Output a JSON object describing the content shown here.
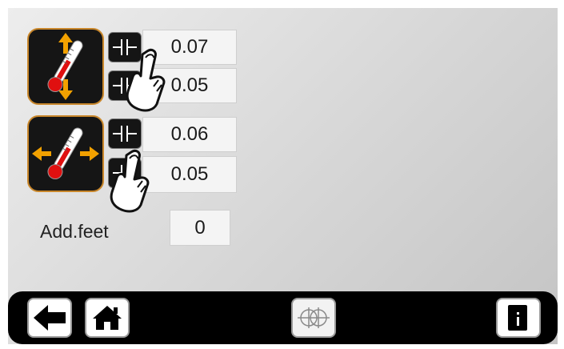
{
  "sensors": [
    {
      "icon": "thermometer-vertical-arrows-icon",
      "upper_value": "0.07",
      "lower_value": "0.05"
    },
    {
      "icon": "thermometer-horizontal-arrows-icon",
      "upper_value": "0.06",
      "lower_value": "0.05"
    }
  ],
  "add_feet": {
    "label": "Add.feet",
    "value": "0"
  },
  "bottom_bar": {
    "buttons": [
      "back-arrow-icon",
      "home-icon",
      "crosshair-icon",
      "info-icon"
    ]
  },
  "colors": {
    "accent": "#f2a100",
    "icon_border": "#c9872b",
    "thermometer_red": "#e01010"
  }
}
